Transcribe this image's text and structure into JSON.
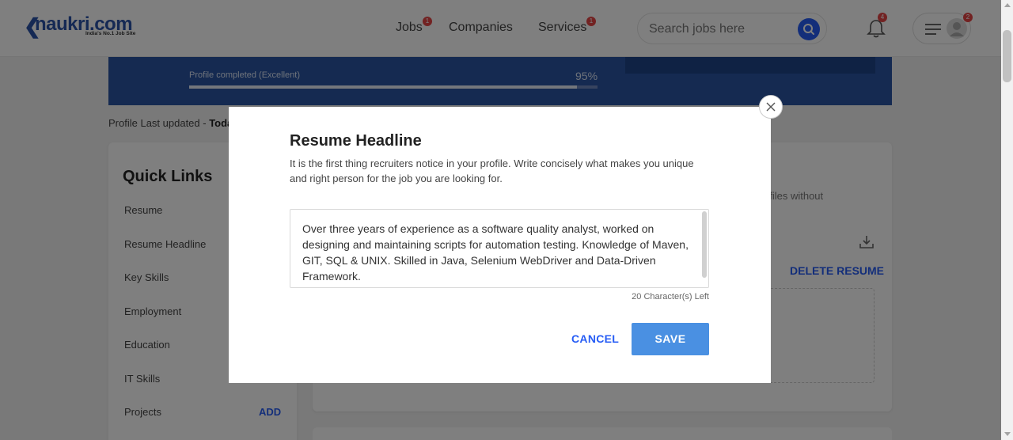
{
  "header": {
    "logo_text": "naukri.com",
    "logo_tagline": "India's No.1 Job Site",
    "nav": [
      {
        "label": "Jobs",
        "badge": "1"
      },
      {
        "label": "Companies"
      },
      {
        "label": "Services",
        "badge": "1"
      }
    ],
    "search_placeholder": "Search jobs here",
    "notification_count": "4",
    "menu_badge": "2",
    "accent_color": "#275df5"
  },
  "profile": {
    "completion_label": "Profile completed (Excellent)",
    "completion_percent": "95%",
    "completion_fraction": 0.95,
    "last_updated_prefix": "Profile Last updated - ",
    "last_updated_value": "Toda"
  },
  "quick_links": {
    "title": "Quick Links",
    "items": [
      "Resume",
      "Resume Headline",
      "Key Skills",
      "Employment",
      "Education",
      "IT Skills",
      "Projects"
    ],
    "projects_action": "ADD"
  },
  "resume_card": {
    "note_fragment": "ofiles without",
    "delete_label": "DELETE RESUME"
  },
  "modal": {
    "title": "Resume Headline",
    "description": "It is the first thing recruiters notice in your profile. Write concisely what makes you unique and right person for the job you are looking for.",
    "headline_value": "Over three years of experience as a software quality analyst, worked on designing and maintaining scripts for automation testing. Knowledge of Maven, GIT, SQL & UNIX. Skilled in Java, Selenium WebDriver and Data-Driven Framework.",
    "characters_left": "20 Character(s) Left",
    "cancel_label": "CANCEL",
    "save_label": "SAVE"
  }
}
